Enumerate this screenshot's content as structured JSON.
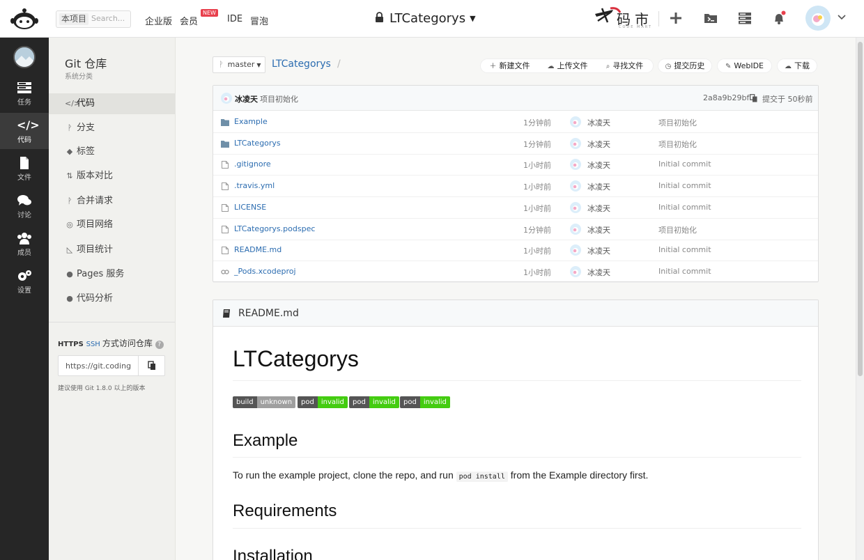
{
  "topbar": {
    "scope_tag": "本项目",
    "search_placeholder": "Search...",
    "nav": [
      "企业版",
      "会员",
      "IDE",
      "冒泡"
    ],
    "new_badge": "NEW",
    "repo_title": "LTCategorys",
    "brand": "码市",
    "brand_sub": "CODE MART"
  },
  "leftnav": {
    "items": [
      {
        "label": "任务",
        "icon": "tasks-icon"
      },
      {
        "label": "代码",
        "icon": "code-icon"
      },
      {
        "label": "文件",
        "icon": "file-icon"
      },
      {
        "label": "讨论",
        "icon": "discussion-icon"
      },
      {
        "label": "成员",
        "icon": "members-icon"
      },
      {
        "label": "设置",
        "icon": "settings-icon"
      }
    ]
  },
  "subnav": {
    "title": "Git 仓库",
    "subtitle": "系统分类",
    "items": [
      {
        "label": "代码",
        "glyph": "</>"
      },
      {
        "label": "分支",
        "glyph": "ᚹ"
      },
      {
        "label": "标签",
        "glyph": "◆"
      },
      {
        "label": "版本对比",
        "glyph": "⇅"
      },
      {
        "label": "合并请求",
        "glyph": "ᚹ"
      },
      {
        "label": "项目网络",
        "glyph": "◎"
      },
      {
        "label": "项目统计",
        "glyph": "◺"
      },
      {
        "label": "Pages 服务",
        "glyph": "●"
      },
      {
        "label": "代码分析",
        "glyph": "●"
      }
    ],
    "access": {
      "https": "HTTPS",
      "ssh": "SSH",
      "title": "方式访问仓库",
      "url": "https://git.coding",
      "note": "建议使用 Git 1.8.0 以上的版本"
    }
  },
  "repo": {
    "branch": "master",
    "name": "LTCategorys",
    "slash": "/",
    "actions": {
      "new_file": "新建文件",
      "upload_file": "上传文件",
      "find_file": "寻找文件",
      "history": "提交历史",
      "webide": "WebIDE",
      "download": "下载"
    }
  },
  "last_commit": {
    "author": "冰凌天",
    "message": "项目初始化",
    "hash": "2a8a9b29bf",
    "time": "提交于 50秒前"
  },
  "files": [
    {
      "name": "Example",
      "type": "folder",
      "time": "1分钟前",
      "author": "冰凌天",
      "message": "项目初始化"
    },
    {
      "name": "LTCategorys",
      "type": "folder",
      "time": "1分钟前",
      "author": "冰凌天",
      "message": "项目初始化"
    },
    {
      "name": ".gitignore",
      "type": "file",
      "time": "1小时前",
      "author": "冰凌天",
      "message": "Initial commit"
    },
    {
      "name": ".travis.yml",
      "type": "file",
      "time": "1小时前",
      "author": "冰凌天",
      "message": "Initial commit"
    },
    {
      "name": "LICENSE",
      "type": "file",
      "time": "1小时前",
      "author": "冰凌天",
      "message": "Initial commit"
    },
    {
      "name": "LTCategorys.podspec",
      "type": "file",
      "time": "1分钟前",
      "author": "冰凌天",
      "message": "项目初始化"
    },
    {
      "name": "README.md",
      "type": "file",
      "time": "1小时前",
      "author": "冰凌天",
      "message": "Initial commit"
    },
    {
      "name": "_Pods.xcodeproj",
      "type": "link",
      "time": "1小时前",
      "author": "冰凌天",
      "message": "Initial commit"
    }
  ],
  "readme": {
    "filename": "README.md",
    "h1": "LTCategorys",
    "badges": [
      {
        "left": "build",
        "right": "unknown",
        "color": "#9f9f9f"
      },
      {
        "left": "pod",
        "right": "invalid",
        "color": "#4c1"
      },
      {
        "left": "pod",
        "right": "invalid",
        "color": "#4c1"
      },
      {
        "left": "pod",
        "right": "invalid",
        "color": "#4c1"
      }
    ],
    "h2_example": "Example",
    "p_before": "To run the example project, clone the repo, and run ",
    "p_code": "pod install",
    "p_after": " from the Example directory first.",
    "h2_requirements": "Requirements",
    "h2_installation": "Installation"
  },
  "colors": {
    "link": "#2b6cb0",
    "sidebar_dark": "#262626",
    "badge_red": "#e8404d"
  }
}
